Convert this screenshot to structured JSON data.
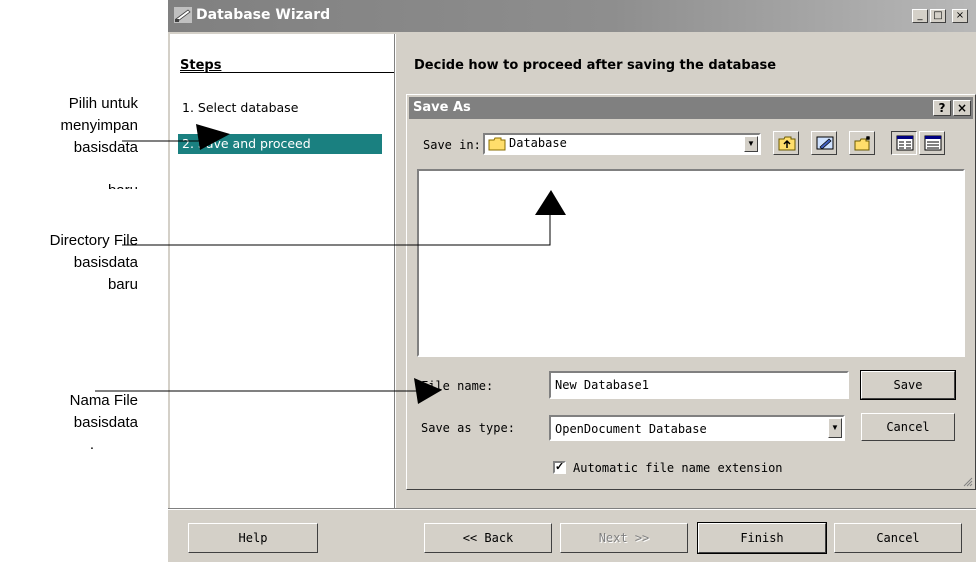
{
  "annotations": {
    "save_new": [
      "Pilih untuk",
      "menyimpan",
      "basisdata",
      "baru"
    ],
    "directory": [
      "Directory File",
      "basisdata",
      "baru"
    ],
    "filename": [
      "Nama File",
      "basisdata",
      "."
    ]
  },
  "window": {
    "title": "Database Wizard",
    "controls": {
      "minimize": "_",
      "maximize": "□",
      "close": "×"
    }
  },
  "steps": {
    "heading": "Steps",
    "items": [
      {
        "label": "1.  Select database",
        "active": false
      },
      {
        "label": "2.  Save and proceed",
        "active": true
      }
    ]
  },
  "page_header": "Decide how to proceed after saving the database",
  "save_as": {
    "title": "Save As",
    "help_btn": "?",
    "close_btn": "×",
    "save_in_label": "Save in:",
    "save_in_value": "Database",
    "file_name_label": "File name:",
    "file_name_value": "New Database1",
    "save_as_type_label": "Save as type:",
    "save_as_type_value": "OpenDocument Database",
    "save_button": "Save",
    "cancel_button": "Cancel",
    "auto_extension_label": "Automatic file name extension",
    "auto_extension_checked": true
  },
  "footer": {
    "help": "Help",
    "back": "<< Back",
    "next": "Next >>",
    "finish": "Finish",
    "cancel": "Cancel"
  }
}
